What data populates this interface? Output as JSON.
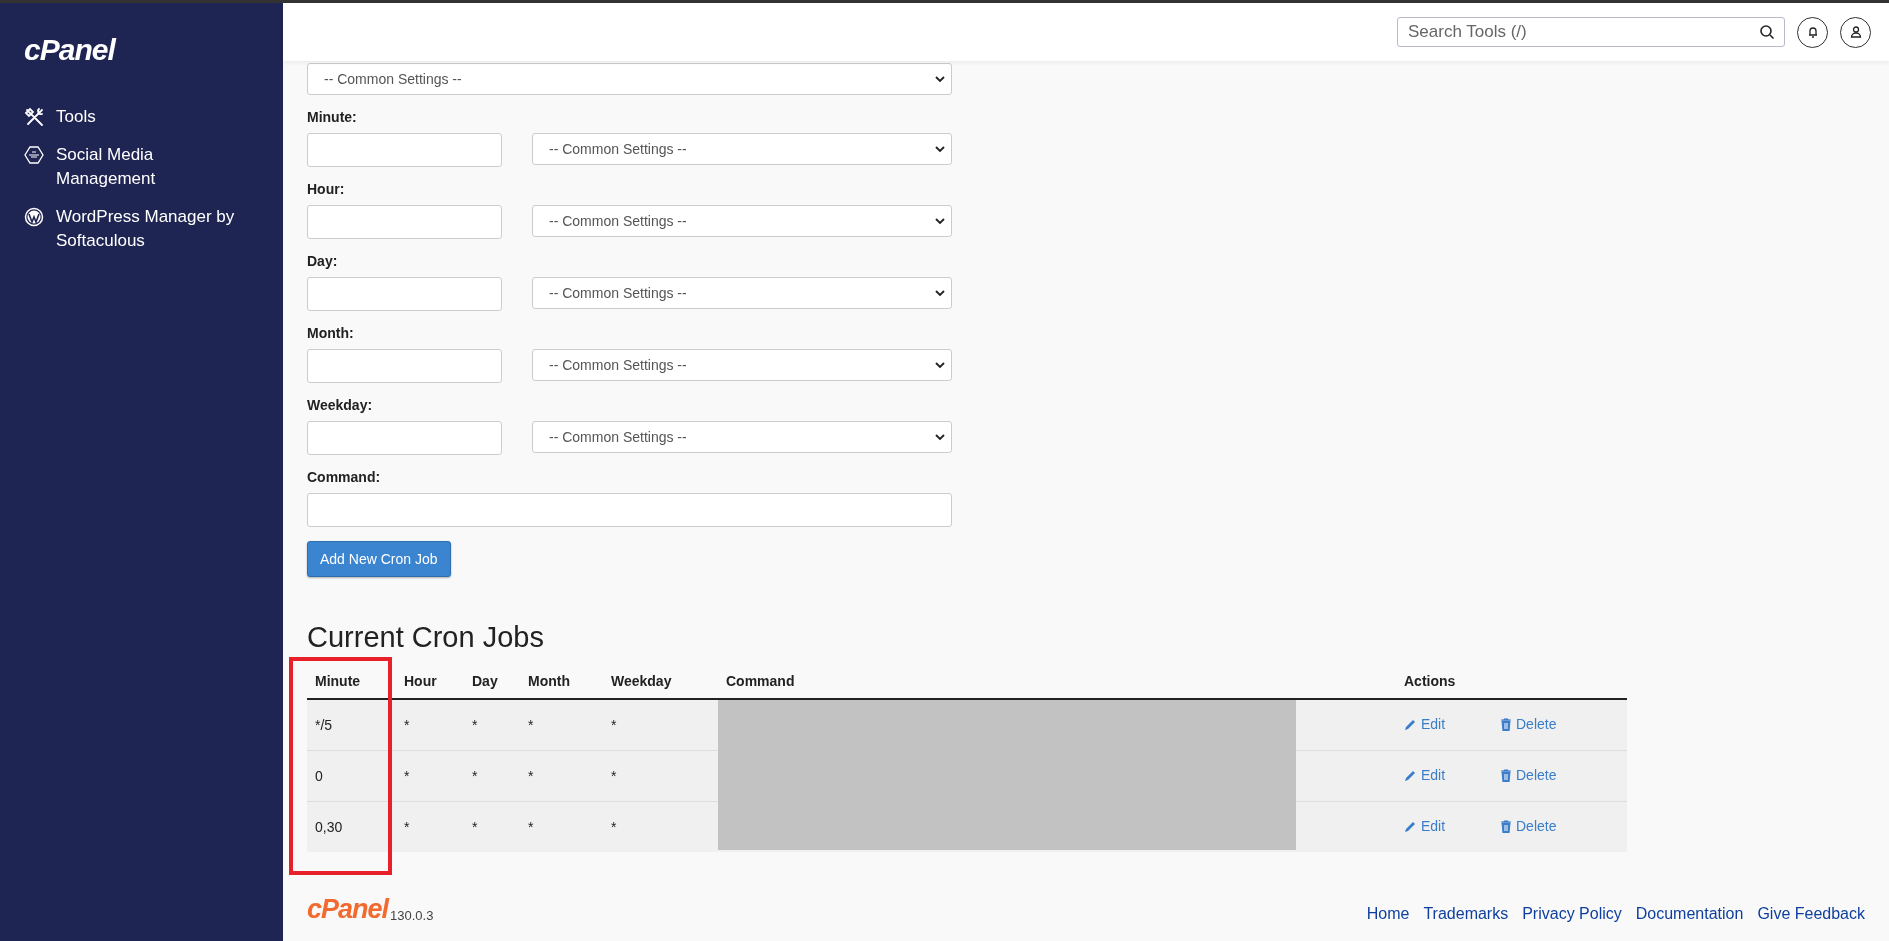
{
  "sidebar": {
    "logo": "cPanel",
    "items": [
      {
        "label": "Tools",
        "selected": false
      },
      {
        "label": "Social Media Management",
        "selected": false
      },
      {
        "label": "WordPress Manager by Softaculous",
        "selected": false
      }
    ]
  },
  "header": {
    "search": {
      "placeholder": "Search Tools (/)"
    }
  },
  "form": {
    "top_select": "-- Common Settings --",
    "fields": [
      {
        "label": "Minute:",
        "kind": "timing",
        "select": "-- Common Settings --"
      },
      {
        "label": "Hour:",
        "kind": "timing",
        "select": "-- Common Settings --"
      },
      {
        "label": "Day:",
        "kind": "timing",
        "select": "-- Common Settings --"
      },
      {
        "label": "Month:",
        "kind": "timing",
        "select": "-- Common Settings --"
      },
      {
        "label": "Weekday:",
        "kind": "timing",
        "select": "-- Common Settings --"
      },
      {
        "label": "Command:",
        "kind": "text"
      }
    ],
    "submit": "Add New Cron Job"
  },
  "cron_jobs": {
    "title": "Current Cron Jobs",
    "columns": [
      {
        "label": "Minute",
        "highlighted": true
      },
      {
        "label": "Hour",
        "highlighted": false
      },
      {
        "label": "Day",
        "highlighted": false
      },
      {
        "label": "Month",
        "highlighted": false
      },
      {
        "label": "Weekday",
        "highlighted": false
      },
      {
        "label": "Command",
        "highlighted": false
      },
      {
        "label": "Actions",
        "highlighted": false
      }
    ],
    "command_redacted": true,
    "rows": [
      {
        "minute": "*/5",
        "hour": "*",
        "day": "*",
        "month": "*",
        "weekday": "*",
        "edit": "Edit",
        "delete": "Delete"
      },
      {
        "minute": "0",
        "hour": "*",
        "day": "*",
        "month": "*",
        "weekday": "*",
        "edit": "Edit",
        "delete": "Delete"
      },
      {
        "minute": "0,30",
        "hour": "*",
        "day": "*",
        "month": "*",
        "weekday": "*",
        "edit": "Edit",
        "delete": "Delete"
      }
    ]
  },
  "footer": {
    "logo": "cPanel",
    "version": "130.0.3",
    "links": [
      "Home",
      "Trademarks",
      "Privacy Policy",
      "Documentation",
      "Give Feedback"
    ]
  }
}
